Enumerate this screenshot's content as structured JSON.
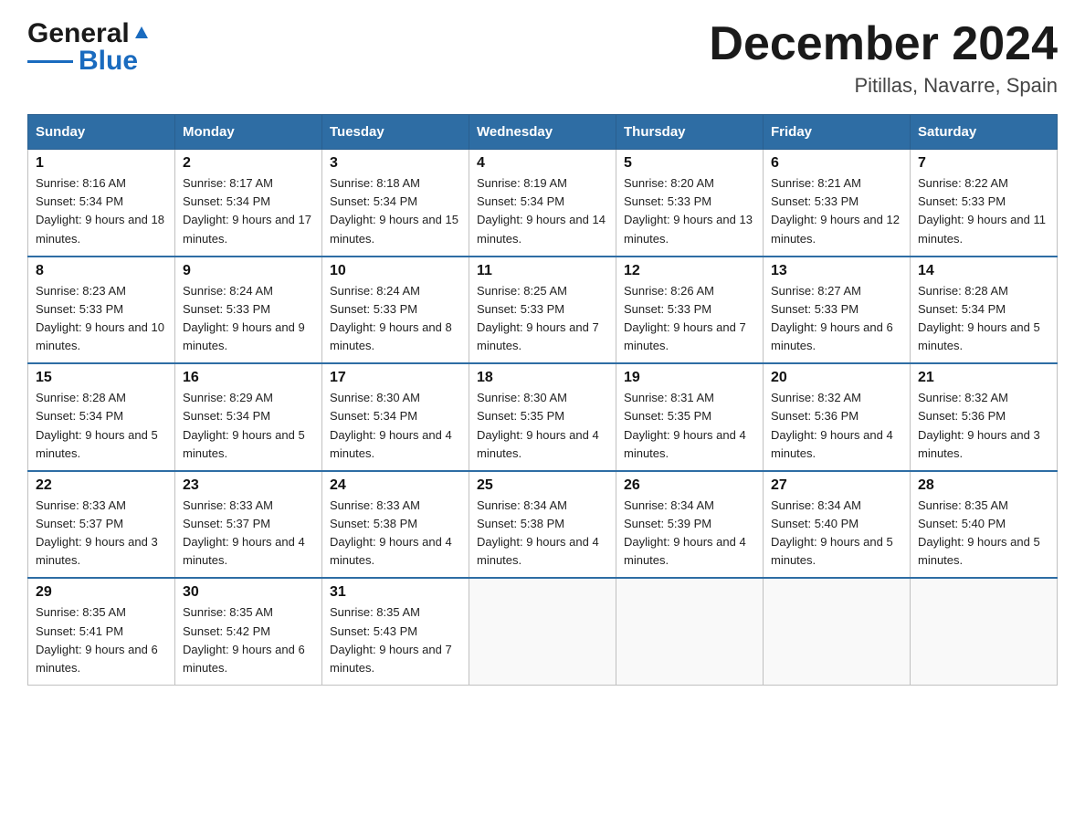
{
  "header": {
    "logo_line1": "General",
    "logo_line2": "Blue",
    "month_title": "December 2024",
    "location": "Pitillas, Navarre, Spain"
  },
  "weekdays": [
    "Sunday",
    "Monday",
    "Tuesday",
    "Wednesday",
    "Thursday",
    "Friday",
    "Saturday"
  ],
  "weeks": [
    [
      {
        "day": "1",
        "sunrise": "8:16 AM",
        "sunset": "5:34 PM",
        "daylight": "9 hours and 18 minutes."
      },
      {
        "day": "2",
        "sunrise": "8:17 AM",
        "sunset": "5:34 PM",
        "daylight": "9 hours and 17 minutes."
      },
      {
        "day": "3",
        "sunrise": "8:18 AM",
        "sunset": "5:34 PM",
        "daylight": "9 hours and 15 minutes."
      },
      {
        "day": "4",
        "sunrise": "8:19 AM",
        "sunset": "5:34 PM",
        "daylight": "9 hours and 14 minutes."
      },
      {
        "day": "5",
        "sunrise": "8:20 AM",
        "sunset": "5:33 PM",
        "daylight": "9 hours and 13 minutes."
      },
      {
        "day": "6",
        "sunrise": "8:21 AM",
        "sunset": "5:33 PM",
        "daylight": "9 hours and 12 minutes."
      },
      {
        "day": "7",
        "sunrise": "8:22 AM",
        "sunset": "5:33 PM",
        "daylight": "9 hours and 11 minutes."
      }
    ],
    [
      {
        "day": "8",
        "sunrise": "8:23 AM",
        "sunset": "5:33 PM",
        "daylight": "9 hours and 10 minutes."
      },
      {
        "day": "9",
        "sunrise": "8:24 AM",
        "sunset": "5:33 PM",
        "daylight": "9 hours and 9 minutes."
      },
      {
        "day": "10",
        "sunrise": "8:24 AM",
        "sunset": "5:33 PM",
        "daylight": "9 hours and 8 minutes."
      },
      {
        "day": "11",
        "sunrise": "8:25 AM",
        "sunset": "5:33 PM",
        "daylight": "9 hours and 7 minutes."
      },
      {
        "day": "12",
        "sunrise": "8:26 AM",
        "sunset": "5:33 PM",
        "daylight": "9 hours and 7 minutes."
      },
      {
        "day": "13",
        "sunrise": "8:27 AM",
        "sunset": "5:33 PM",
        "daylight": "9 hours and 6 minutes."
      },
      {
        "day": "14",
        "sunrise": "8:28 AM",
        "sunset": "5:34 PM",
        "daylight": "9 hours and 5 minutes."
      }
    ],
    [
      {
        "day": "15",
        "sunrise": "8:28 AM",
        "sunset": "5:34 PM",
        "daylight": "9 hours and 5 minutes."
      },
      {
        "day": "16",
        "sunrise": "8:29 AM",
        "sunset": "5:34 PM",
        "daylight": "9 hours and 5 minutes."
      },
      {
        "day": "17",
        "sunrise": "8:30 AM",
        "sunset": "5:34 PM",
        "daylight": "9 hours and 4 minutes."
      },
      {
        "day": "18",
        "sunrise": "8:30 AM",
        "sunset": "5:35 PM",
        "daylight": "9 hours and 4 minutes."
      },
      {
        "day": "19",
        "sunrise": "8:31 AM",
        "sunset": "5:35 PM",
        "daylight": "9 hours and 4 minutes."
      },
      {
        "day": "20",
        "sunrise": "8:32 AM",
        "sunset": "5:36 PM",
        "daylight": "9 hours and 4 minutes."
      },
      {
        "day": "21",
        "sunrise": "8:32 AM",
        "sunset": "5:36 PM",
        "daylight": "9 hours and 3 minutes."
      }
    ],
    [
      {
        "day": "22",
        "sunrise": "8:33 AM",
        "sunset": "5:37 PM",
        "daylight": "9 hours and 3 minutes."
      },
      {
        "day": "23",
        "sunrise": "8:33 AM",
        "sunset": "5:37 PM",
        "daylight": "9 hours and 4 minutes."
      },
      {
        "day": "24",
        "sunrise": "8:33 AM",
        "sunset": "5:38 PM",
        "daylight": "9 hours and 4 minutes."
      },
      {
        "day": "25",
        "sunrise": "8:34 AM",
        "sunset": "5:38 PM",
        "daylight": "9 hours and 4 minutes."
      },
      {
        "day": "26",
        "sunrise": "8:34 AM",
        "sunset": "5:39 PM",
        "daylight": "9 hours and 4 minutes."
      },
      {
        "day": "27",
        "sunrise": "8:34 AM",
        "sunset": "5:40 PM",
        "daylight": "9 hours and 5 minutes."
      },
      {
        "day": "28",
        "sunrise": "8:35 AM",
        "sunset": "5:40 PM",
        "daylight": "9 hours and 5 minutes."
      }
    ],
    [
      {
        "day": "29",
        "sunrise": "8:35 AM",
        "sunset": "5:41 PM",
        "daylight": "9 hours and 6 minutes."
      },
      {
        "day": "30",
        "sunrise": "8:35 AM",
        "sunset": "5:42 PM",
        "daylight": "9 hours and 6 minutes."
      },
      {
        "day": "31",
        "sunrise": "8:35 AM",
        "sunset": "5:43 PM",
        "daylight": "9 hours and 7 minutes."
      },
      null,
      null,
      null,
      null
    ]
  ]
}
